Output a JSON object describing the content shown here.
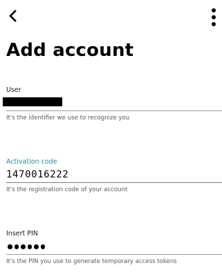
{
  "header": {
    "back_icon": "chevron-left-icon",
    "more_icon": "more-vertical-icon",
    "title": "Add account"
  },
  "form": {
    "user": {
      "label": "User",
      "value": "",
      "value_redacted": true,
      "helper": "It's the identifier we use to recognize you"
    },
    "activation_code": {
      "label": "Activation code",
      "value": "1470016222",
      "helper": "It's the registration code of your account"
    },
    "pin": {
      "label": "Insert PIN",
      "masked_length": 6,
      "helper": "It's the PIN you use to generate temporary access tokens"
    }
  },
  "colors": {
    "accent": "#1a8fa8",
    "text": "#000000",
    "helper_text": "#5a5a5a",
    "underline": "#9a9a9a"
  }
}
